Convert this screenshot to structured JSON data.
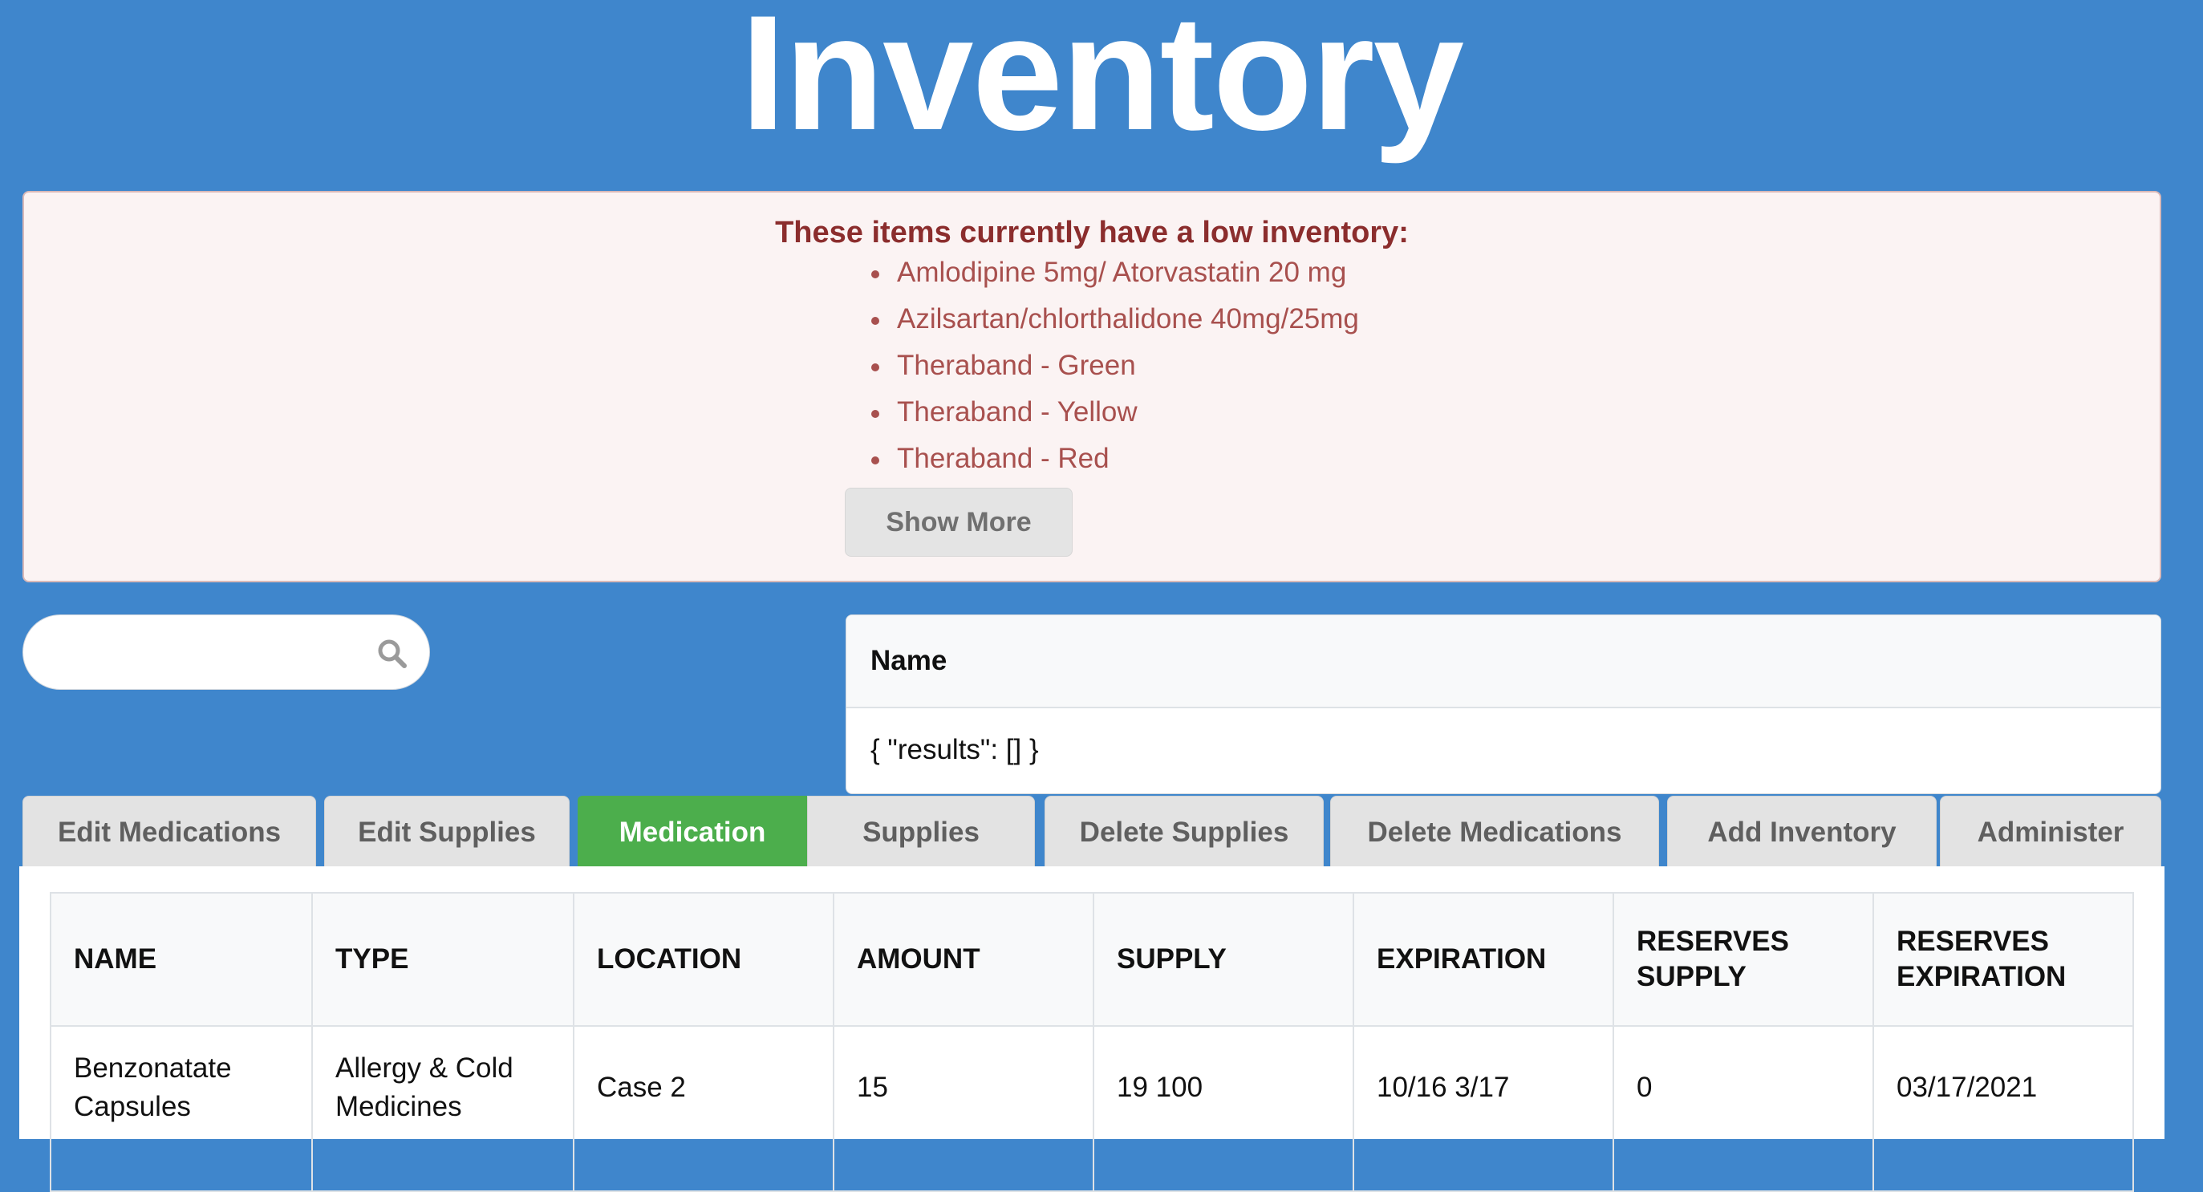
{
  "page": {
    "title": "Inventory"
  },
  "low_inventory_alert": {
    "heading": "These items currently have a low inventory:",
    "items": [
      "Amlodipine 5mg/ Atorvastatin 20 mg",
      "Azilsartan/chlorthalidone 40mg/25mg",
      "Theraband - Green",
      "Theraband - Yellow",
      "Theraband - Red"
    ],
    "show_more_label": "Show More"
  },
  "search": {
    "value": "",
    "placeholder": "",
    "icon": "search-icon"
  },
  "results_panel": {
    "header": "Name",
    "body": "{ \"results\": [] }"
  },
  "tabs": [
    {
      "label": "Edit Medications",
      "active": false
    },
    {
      "label": "Edit Supplies",
      "active": false
    },
    {
      "label": "Medication",
      "active": true
    },
    {
      "label": "Supplies",
      "active": false
    },
    {
      "label": "Delete Supplies",
      "active": false
    },
    {
      "label": "Delete Medications",
      "active": false
    },
    {
      "label": "Add Inventory",
      "active": false
    },
    {
      "label": "Administer",
      "active": false
    }
  ],
  "table": {
    "columns": [
      "NAME",
      "TYPE",
      "LOCATION",
      "AMOUNT",
      "SUPPLY",
      "EXPIRATION",
      "RESERVES SUPPLY",
      "RESERVES EXPIRATION"
    ],
    "rows": [
      [
        "Benzonatate Capsules",
        "Allergy & Cold Medicines",
        "Case 2",
        "15",
        "19 100",
        "10/16 3/17",
        "0",
        "03/17/2021"
      ]
    ]
  },
  "colors": {
    "background": "#3f86cc",
    "active_tab": "#4cae4c",
    "alert_background": "#fbf3f3",
    "alert_heading": "#8b2d2d",
    "alert_item": "#a8504e"
  }
}
